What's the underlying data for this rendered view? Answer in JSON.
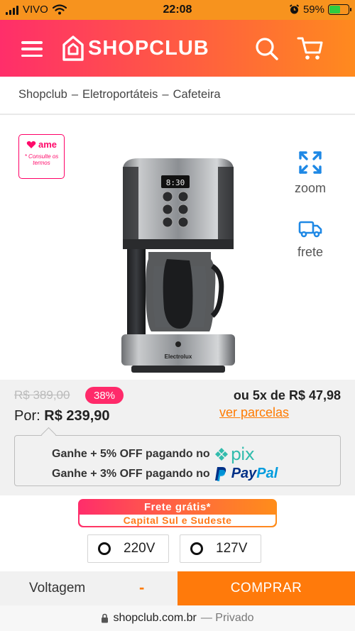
{
  "status_bar": {
    "carrier": "VIVO",
    "time": "22:08",
    "battery_percent": "59%",
    "battery_level": 0.59,
    "icons": [
      "signal-icon",
      "wifi-icon",
      "alarm-icon",
      "battery-icon"
    ]
  },
  "header": {
    "logo_text": "SHOPCLUB",
    "icons": [
      "menu-icon",
      "shopclub-logo-icon",
      "search-icon",
      "cart-icon"
    ],
    "gradient_colors": [
      "#ff2e6a",
      "#ff5a43",
      "#ff8a1e"
    ]
  },
  "breadcrumb": {
    "items": [
      "Shopclub",
      "Eletroportáteis",
      "Cafeteira"
    ],
    "separator": "–"
  },
  "product": {
    "ame": {
      "logo_text": "ame",
      "note": "* Consulte os termos"
    },
    "image_brand_text": "Electrolux",
    "image_display_text": "8:30",
    "actions": {
      "zoom": "zoom",
      "frete": "frete"
    }
  },
  "price": {
    "old_price": "R$ 389,00",
    "discount": "38%",
    "installments": "ou 5x de R$ 47,98",
    "por_label": "Por:",
    "current_price": "R$ 239,90",
    "ver_parcelas": "ver parcelas"
  },
  "promos": {
    "pix_line": "Ganhe + 5% OFF pagando no",
    "pix_brand": "pix",
    "paypal_line": "Ganhe + 3% OFF pagando no",
    "paypal_brand_pay": "Pay",
    "paypal_brand_pal": "Pal"
  },
  "shipping": {
    "title": "Frete grátis*",
    "subtitle": "Capital Sul e Sudeste"
  },
  "voltage_options": [
    {
      "label": "220V"
    },
    {
      "label": "127V"
    }
  ],
  "bottom_bar": {
    "voltage_label": "Voltagem",
    "voltage_value": "-",
    "buy_label": "COMPRAR"
  },
  "browser": {
    "domain": "shopclub.com.br",
    "mode": "— Privado"
  },
  "colors": {
    "accent_orange": "#ff7a0b",
    "accent_pink": "#ff2a6a",
    "pix": "#32bcad",
    "paypal_dark": "#003087",
    "paypal_light": "#009cde"
  }
}
